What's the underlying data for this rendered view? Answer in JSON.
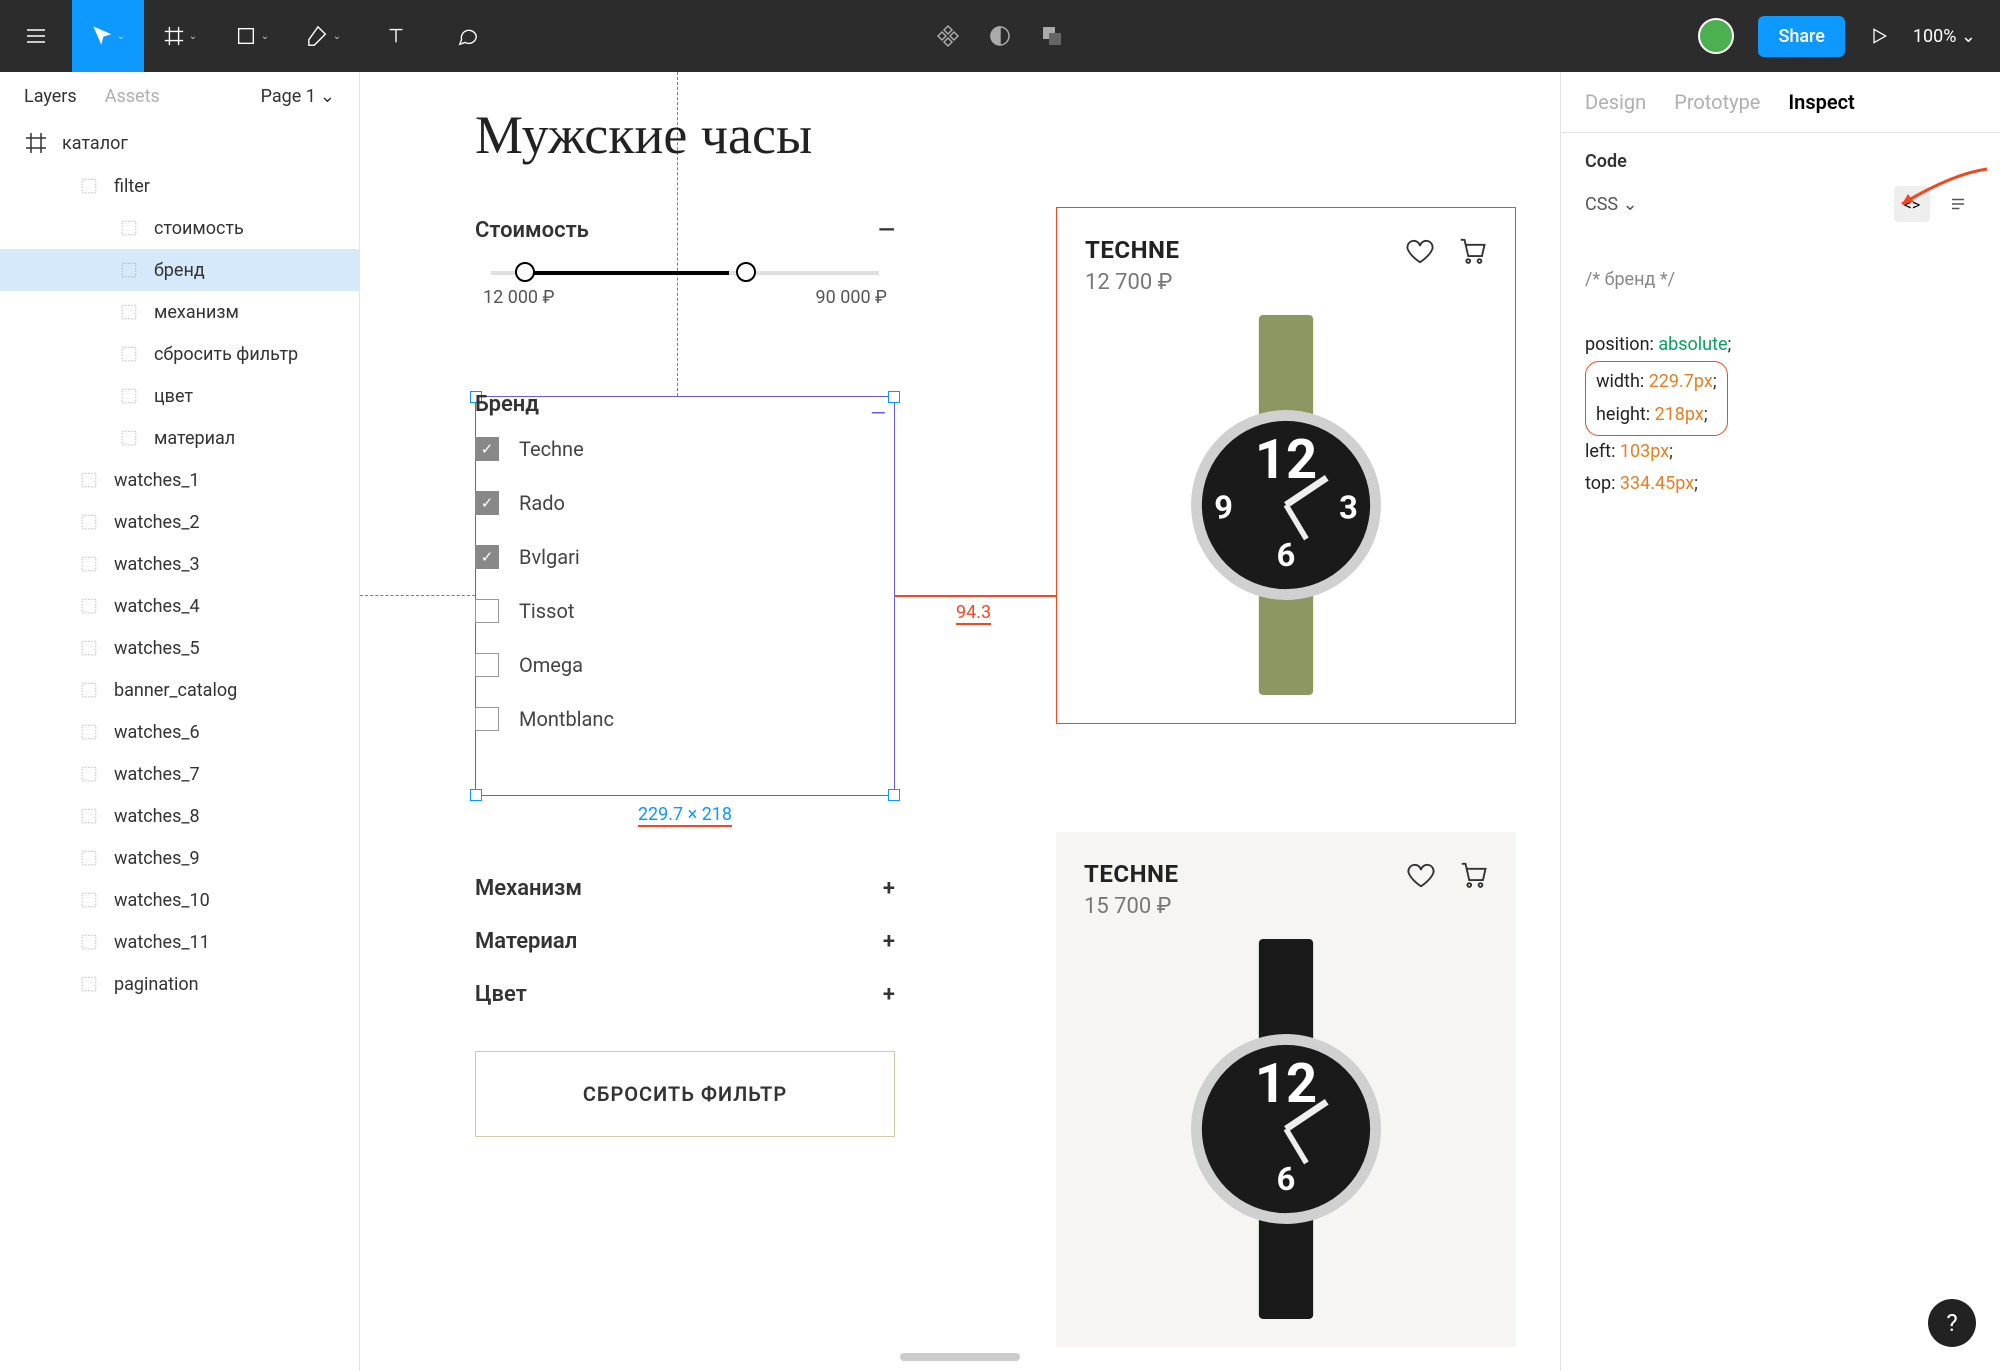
{
  "toolbar": {
    "share": "Share",
    "zoom": "100%"
  },
  "leftPanel": {
    "tabs": {
      "layers": "Layers",
      "assets": "Assets"
    },
    "page": "Page 1",
    "root": "каталог",
    "layers": [
      "filter",
      "стоимость",
      "бренд",
      "механизм",
      "сбросить фильтр",
      "цвет",
      "материал",
      "watches_1",
      "watches_2",
      "watches_3",
      "watches_4",
      "watches_5",
      "banner_catalog",
      "watches_6",
      "watches_7",
      "watches_8",
      "watches_9",
      "watches_10",
      "watches_11",
      "pagination"
    ]
  },
  "canvas": {
    "title": "Мужские часы",
    "price": {
      "label": "Стоимость",
      "min": "12 000 ₽",
      "max": "90 000 ₽"
    },
    "brand": {
      "label": "Бренд",
      "items": [
        {
          "name": "Techne",
          "checked": true
        },
        {
          "name": "Rado",
          "checked": true
        },
        {
          "name": "Bvlgari",
          "checked": true
        },
        {
          "name": "Tissot",
          "checked": false
        },
        {
          "name": "Omega",
          "checked": false
        },
        {
          "name": "Montblanc",
          "checked": false
        }
      ]
    },
    "sections": {
      "mechanism": "Механизм",
      "material": "Материал",
      "color": "Цвет"
    },
    "resetBtn": "СБРОСИТЬ ФИЛЬТР",
    "products": [
      {
        "brand": "TECHNE",
        "price": "12 700 ₽"
      },
      {
        "brand": "TECHNE",
        "price": "15 700 ₽"
      }
    ],
    "selectionDim": "229.7 × 218",
    "distance": "94.3"
  },
  "inspect": {
    "tabs": {
      "design": "Design",
      "prototype": "Prototype",
      "inspect": "Inspect"
    },
    "codeLabel": "Code",
    "lang": "CSS",
    "code": {
      "comment": "/* бренд */",
      "l1k": "position:",
      "l1v": "absolute",
      "l2k": "width:",
      "l2v": "229.7px",
      "l3k": "height:",
      "l3v": "218px",
      "l4k": "left:",
      "l4v": "103px",
      "l5k": "top:",
      "l5v": "334.45px"
    }
  }
}
